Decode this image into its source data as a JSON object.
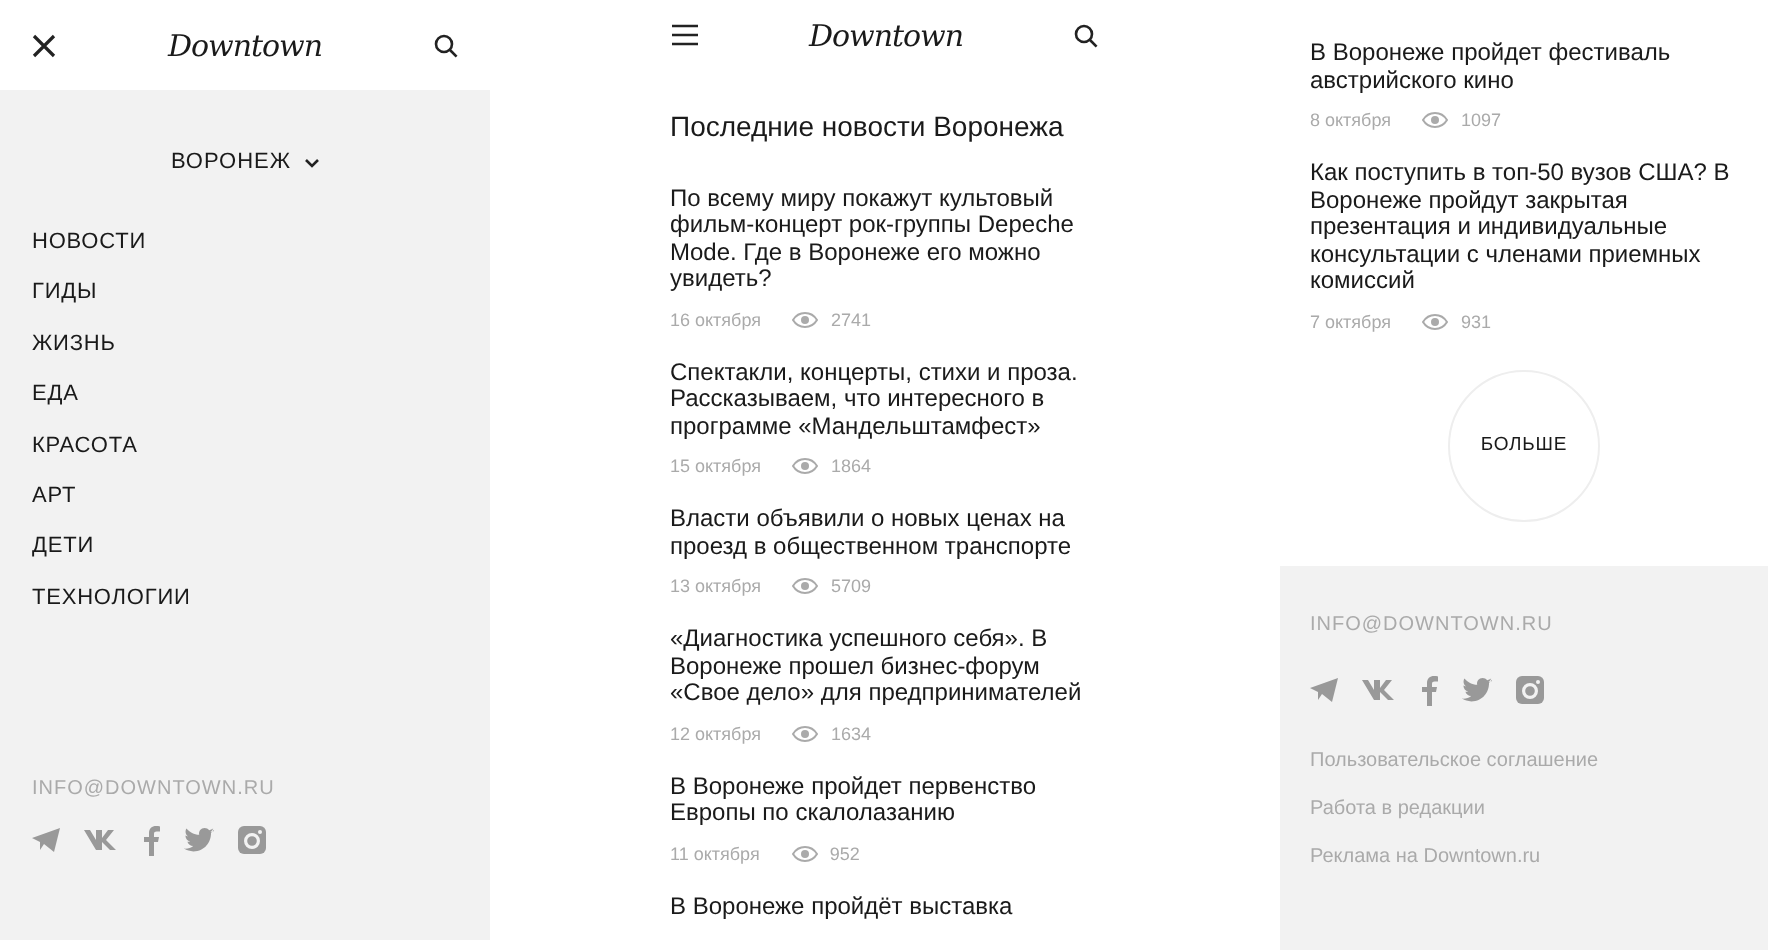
{
  "menu_screen": {
    "logo": "Downtown",
    "city": "ВОРОНЕЖ",
    "city_expanded": false,
    "menu_items": [
      "НОВОСТИ",
      "ГИДЫ",
      "ЖИЗНЬ",
      "ЕДА",
      "КРАСОТА",
      "АРТ",
      "ДЕТИ",
      "ТЕХНОЛОГИИ"
    ],
    "email": "INFO@DOWNTOWN.RU"
  },
  "news_screen": {
    "logo": "Downtown",
    "title": "Последние новости Воронежа",
    "articles": [
      {
        "title": "По всему миру покажут культовый фильм-концерт рок-группы Depeche Mode. Где в Воронеже его можно увидеть?",
        "date": "16 октября",
        "views": "2741"
      },
      {
        "title": "Спектакли, концерты, стихи и проза. Рассказываем, что интересного в программе «Мандельштамфест»",
        "date": "15 октября",
        "views": "1864"
      },
      {
        "title": "Власти объявили о новых ценах на проезд в общественном транспорте",
        "date": "13 октября",
        "views": "5709"
      },
      {
        "title": "«Диагностика успешного себя». В Воронеже прошел бизнес-форум «Свое дело» для предпринимателей",
        "date": "12 октября",
        "views": "1634"
      },
      {
        "title": "В Воронеже пройдет первенство Европы по скалолазанию",
        "date": "11 октября",
        "views": "952"
      },
      {
        "title": "В Воронеже пройдёт выставка"
      }
    ]
  },
  "more_screen": {
    "articles": [
      {
        "title": "В Воронеже пройдет фестиваль австрийского кино",
        "date": "8 октября",
        "views": "1097"
      },
      {
        "title": "Как поступить в топ-50 вузов США? В Воронеже пройдут закрытая презентация и индивидуальные консультации с членами приемных комиссий",
        "date": "7 октября",
        "views": "931"
      }
    ],
    "more_button": "БОЛЬШЕ",
    "email": "INFO@DOWNTOWN.RU",
    "footer_links": [
      "Пользовательское соглашение",
      "Работа в редакции",
      "Реклама на Downtown.ru"
    ]
  }
}
